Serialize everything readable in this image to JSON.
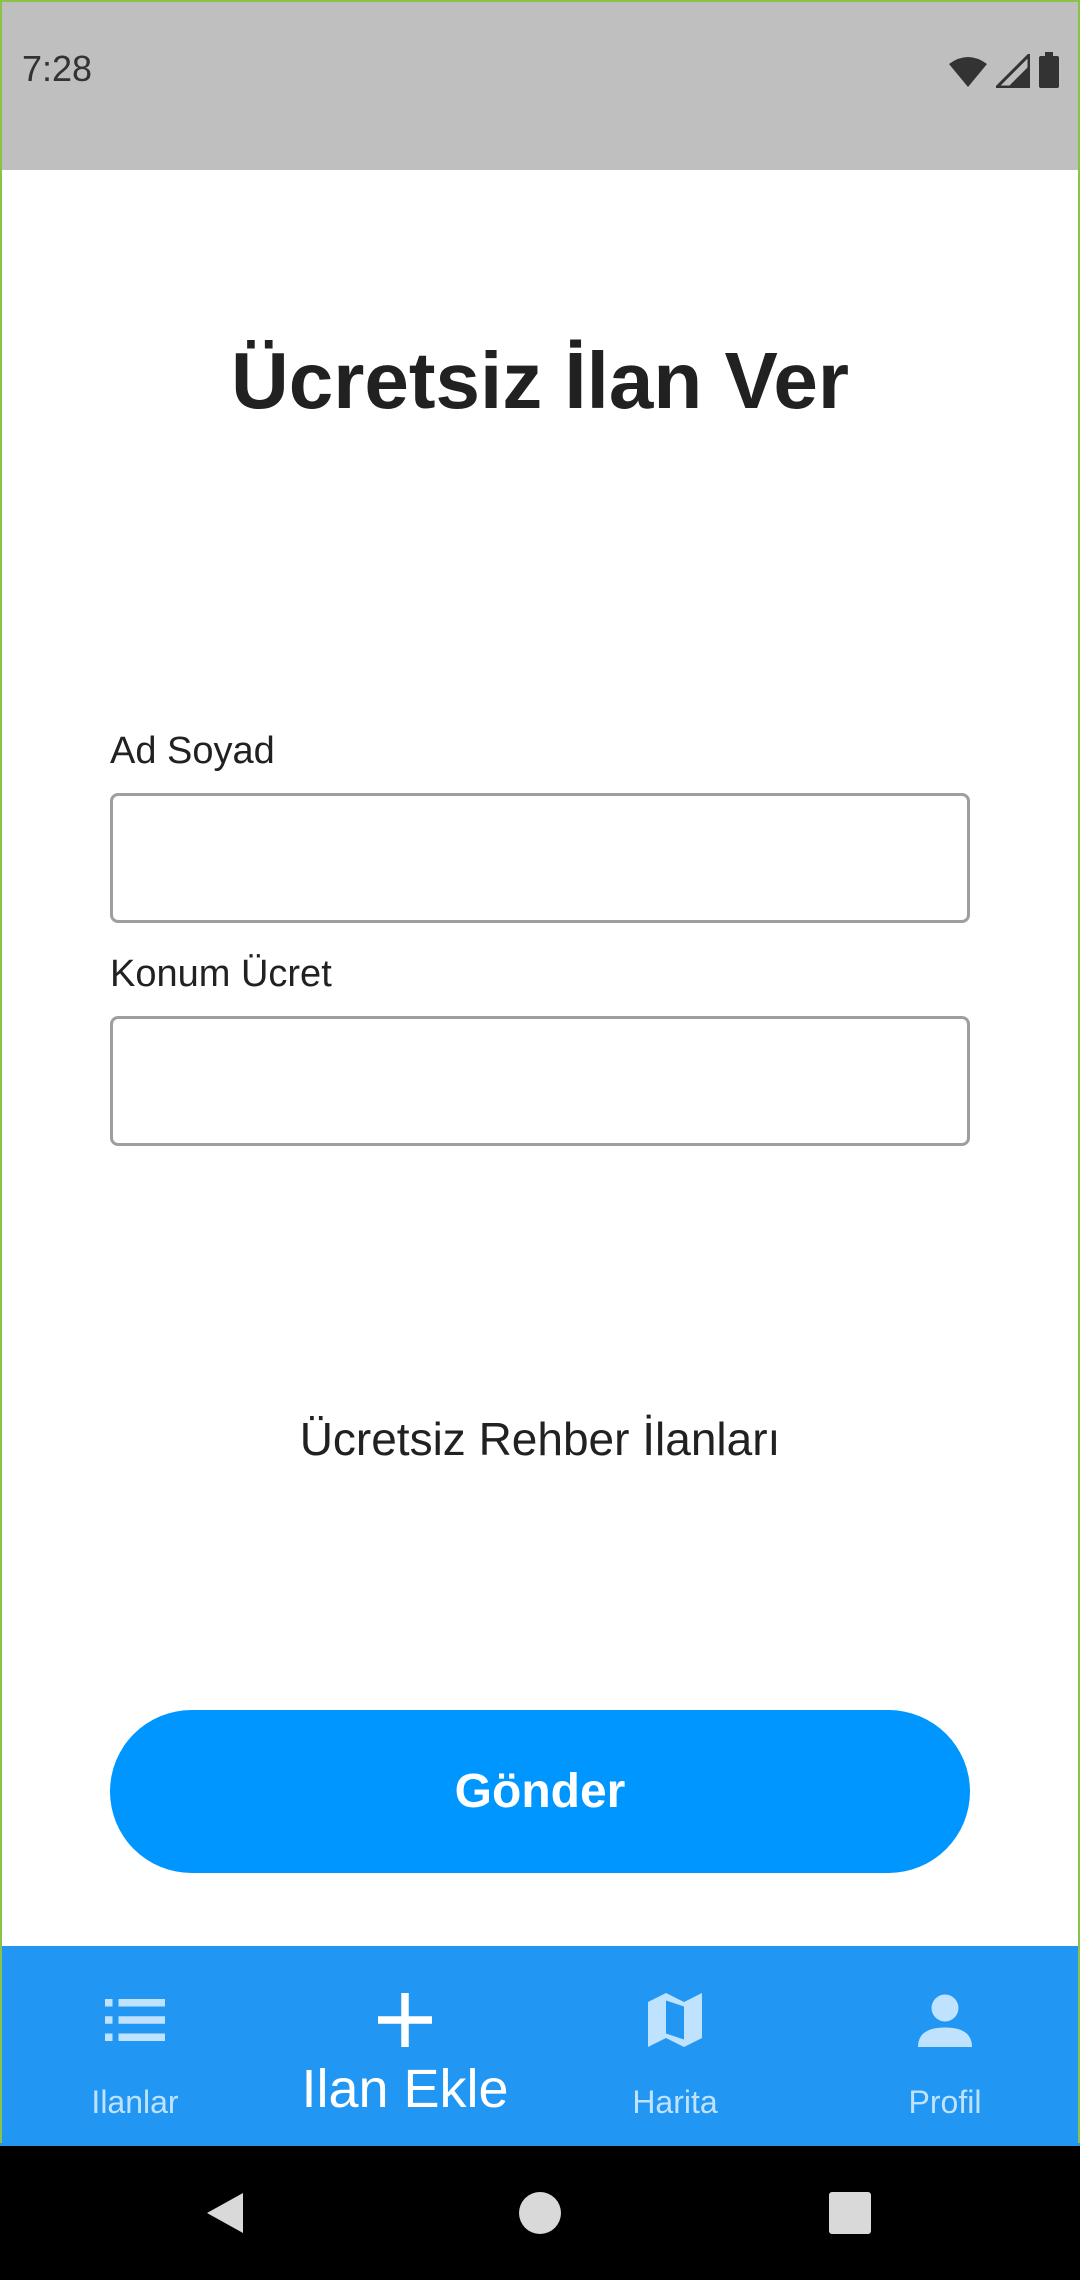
{
  "status_bar": {
    "time": "7:28",
    "icons": [
      "wifi-icon",
      "cellular-signal-icon",
      "battery-icon"
    ]
  },
  "page": {
    "title": "Ücretsiz İlan Ver"
  },
  "form": {
    "name_label": "Ad Soyad",
    "name_value": "",
    "location_label": "Konum Ücret",
    "location_value": "",
    "guide_link": "Ücretsiz Rehber İlanları",
    "submit_label": "Gönder"
  },
  "bottom_nav": {
    "items": [
      {
        "label": "Ilanlar",
        "icon": "list-icon",
        "active": false
      },
      {
        "label": "Ilan Ekle",
        "icon": "plus-icon",
        "active": true
      },
      {
        "label": "Harita",
        "icon": "map-icon",
        "active": false
      },
      {
        "label": "Profil",
        "icon": "person-icon",
        "active": false
      }
    ]
  },
  "system_nav": {
    "icons": [
      "back-icon",
      "home-icon",
      "recents-icon"
    ]
  },
  "colors": {
    "accent": "#0096ff",
    "nav_bar": "#2196f3",
    "status_bar": "#bfbfbf",
    "frame_border": "#8bc34a"
  }
}
